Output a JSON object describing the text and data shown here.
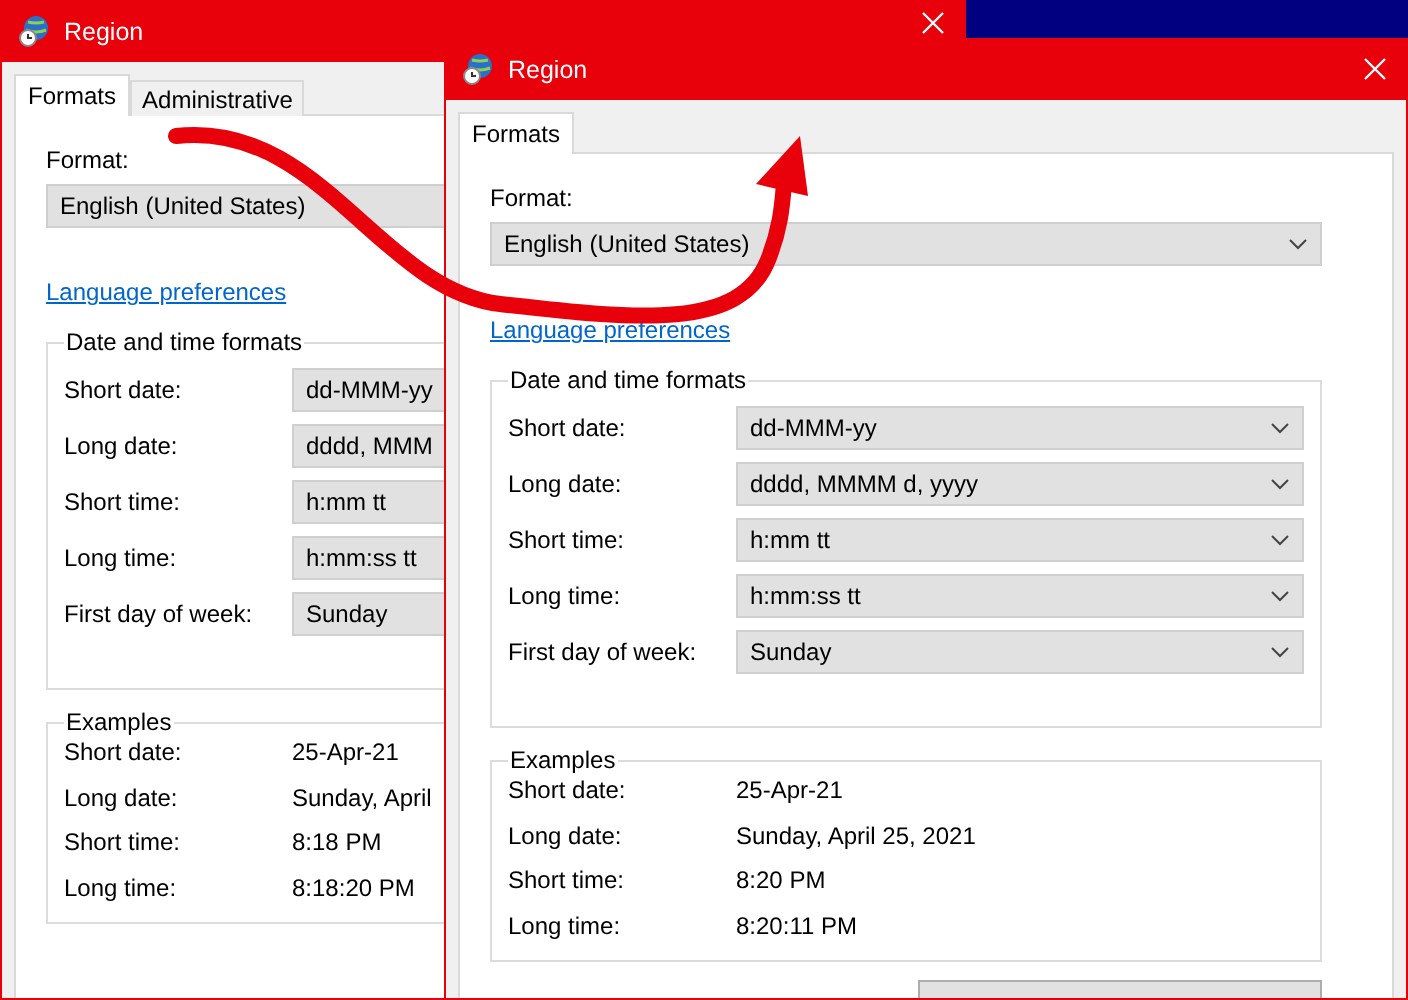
{
  "windows": [
    {
      "title": "Region",
      "tabs": [
        {
          "label": "Formats",
          "selected": true
        },
        {
          "label": "Administrative",
          "selected": false
        }
      ],
      "format_label": "Format:",
      "format_value": "English (United States)",
      "link": "Language preferences",
      "date_time_formats": {
        "title": "Date and time formats",
        "rows": [
          {
            "label": "Short date:",
            "value": "dd-MMM-yy"
          },
          {
            "label": "Long date:",
            "value": "dddd, MMM"
          },
          {
            "label": "Short time:",
            "value": "h:mm tt"
          },
          {
            "label": "Long time:",
            "value": "h:mm:ss tt"
          },
          {
            "label": "First day of week:",
            "value": "Sunday"
          }
        ]
      },
      "examples": {
        "title": "Examples",
        "rows": [
          {
            "label": "Short date:",
            "value": "25-Apr-21"
          },
          {
            "label": "Long date:",
            "value": "Sunday, April"
          },
          {
            "label": "Short time:",
            "value": "8:18 PM"
          },
          {
            "label": "Long time:",
            "value": "8:18:20 PM"
          }
        ]
      }
    },
    {
      "title": "Region",
      "tabs": [
        {
          "label": "Formats",
          "selected": true
        }
      ],
      "format_label": "Format:",
      "format_value": "English (United States)",
      "link": "Language preferences",
      "date_time_formats": {
        "title": "Date and time formats",
        "rows": [
          {
            "label": "Short date:",
            "value": "dd-MMM-yy"
          },
          {
            "label": "Long date:",
            "value": "dddd, MMMM d, yyyy"
          },
          {
            "label": "Short time:",
            "value": "h:mm tt"
          },
          {
            "label": "Long time:",
            "value": "h:mm:ss tt"
          },
          {
            "label": "First day of week:",
            "value": "Sunday"
          }
        ]
      },
      "examples": {
        "title": "Examples",
        "rows": [
          {
            "label": "Short date:",
            "value": "25-Apr-21"
          },
          {
            "label": "Long date:",
            "value": "Sunday, April 25, 2021"
          },
          {
            "label": "Short time:",
            "value": "8:20 PM"
          },
          {
            "label": "Long time:",
            "value": "8:20:11 PM"
          }
        ]
      },
      "has_settings_button": true
    }
  ]
}
